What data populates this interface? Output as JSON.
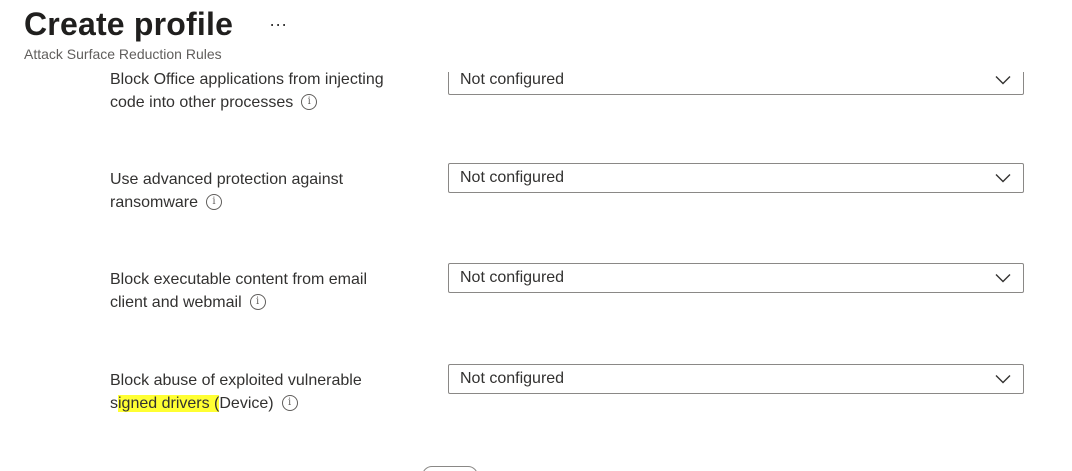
{
  "header": {
    "title": "Create profile",
    "more": "···",
    "subtitle": "Attack Surface Reduction Rules"
  },
  "settings": [
    {
      "label_line1": "Block Office applications from injecting",
      "label_line2": "code into other processes",
      "value": "Not configured"
    },
    {
      "label_line1": "Use advanced protection against",
      "label_line2": "ransomware",
      "value": "Not configured"
    },
    {
      "label_line1": "Block executable content from email",
      "label_line2": "client and webmail",
      "value": "Not configured"
    },
    {
      "label_line1": "Block abuse of exploited vulnerable",
      "label_line2_pre": "s",
      "label_line2_hl": "igned drivers (",
      "label_line2_post": "Device)",
      "value": "Not configured"
    }
  ],
  "icons": {
    "info": "i",
    "chevron": "chevron-down-icon"
  },
  "colors": {
    "highlight": "#ffff33",
    "border": "#8a8886",
    "text": "#323130"
  }
}
